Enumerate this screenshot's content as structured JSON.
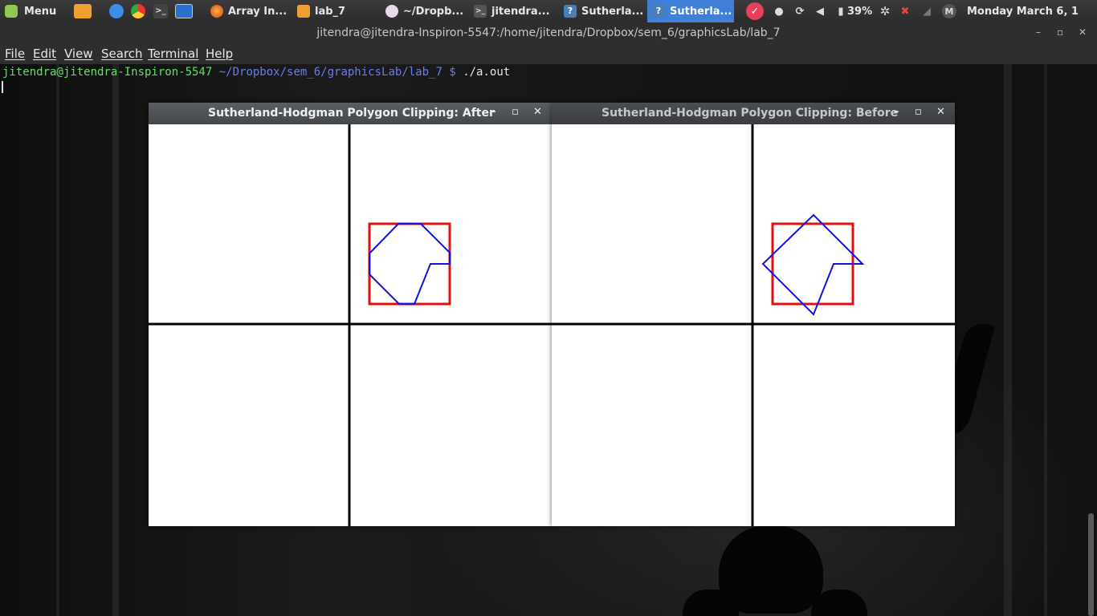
{
  "panel": {
    "menu_label": "Menu",
    "tasks": [
      {
        "label": "Array In...",
        "icon": "firefox-icon",
        "active": false
      },
      {
        "label": "lab_7",
        "icon": "folder-icon",
        "active": false
      },
      {
        "label": "~/Dropb...",
        "icon": "dropbox-icon",
        "active": false
      },
      {
        "label": "jitendra...",
        "icon": "terminal-icon",
        "active": false
      },
      {
        "label": "Sutherla...",
        "icon": "window-icon",
        "active": false
      },
      {
        "label": "Sutherla...",
        "icon": "window-icon",
        "active": true
      }
    ],
    "battery": "39%",
    "clock": "Monday March  6, 1"
  },
  "terminal": {
    "title": "jitendra@jitendra-Inspiron-5547:/home/jitendra/Dropbox/sem_6/graphicsLab/lab_7",
    "menus": [
      "File",
      "Edit",
      "View",
      "Search",
      "Terminal",
      "Help"
    ],
    "prompt_user": "jitendra@jitendra-Inspiron-5547",
    "prompt_path": "~/Dropbox/sem_6/graphicsLab/lab_7",
    "prompt_symbol": "$",
    "command": "./a.out"
  },
  "windows": {
    "after": {
      "title": "Sutherland-Hodgman Polygon Clipping: After"
    },
    "before": {
      "title": "Sutherland-Hodgman Polygon Clipping: Before"
    }
  },
  "colors": {
    "clip_window": "#e01010",
    "polygon": "#1010e0",
    "axes": "#000000",
    "accent": "#3f7fd6",
    "prompt_user": "#5fe35f",
    "prompt_path": "#6a7cf5"
  }
}
